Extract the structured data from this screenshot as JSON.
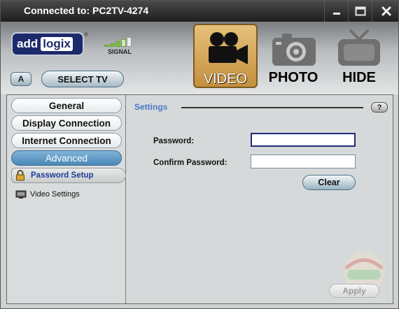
{
  "window": {
    "title": "Connected to: PC2TV-4274",
    "controls": [
      "minimize-icon",
      "maximize-icon",
      "close-icon"
    ]
  },
  "header": {
    "logo": {
      "part1": "add",
      "part2": "logix",
      "reg": "®"
    },
    "signal": {
      "label": "SIGNAL",
      "level": 0.6
    },
    "lang_button": "A",
    "select_tv_label": "SELECT TV",
    "modes": [
      {
        "label": "VIDEO",
        "icon": "video-camera-icon",
        "active": true
      },
      {
        "label": "PHOTO",
        "icon": "photo-camera-icon",
        "active": false
      },
      {
        "label": "HIDE",
        "icon": "tv-icon",
        "active": false
      }
    ]
  },
  "sidebar": {
    "items": [
      {
        "label": "General",
        "active": false
      },
      {
        "label": "Display Connection",
        "active": false
      },
      {
        "label": "Internet Connection",
        "active": false
      },
      {
        "label": "Advanced",
        "active": true
      }
    ],
    "subitems": [
      {
        "label": "Password Setup",
        "icon": "lock-icon",
        "active": true
      },
      {
        "label": "Video Settings",
        "icon": "video-settings-icon",
        "active": false
      }
    ]
  },
  "panel": {
    "title": "Settings",
    "help_label": "?",
    "password_label": "Password:",
    "password_value": "",
    "confirm_label": "Confirm Password:",
    "confirm_value": "",
    "clear_label": "Clear",
    "apply_label": "Apply"
  },
  "colors": {
    "active_nav": "#4a88b8",
    "settings_title": "#4b78c6",
    "subitem_text": "#1c3d9a",
    "video_active": "#d9aa5c"
  }
}
